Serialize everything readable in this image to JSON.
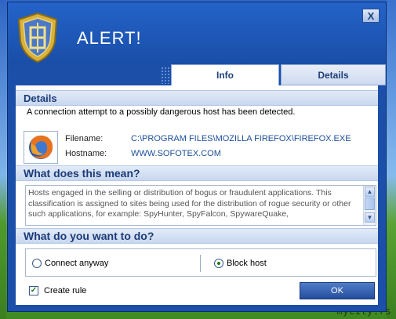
{
  "window": {
    "title": "ALERT!",
    "close_label": "X"
  },
  "tabs": [
    {
      "label": "Info",
      "active": true
    },
    {
      "label": "Details",
      "active": false
    }
  ],
  "details": {
    "heading": "Details",
    "message": "A connection attempt to a possibly dangerous host has been detected.",
    "filename_label": "Filename:",
    "filename_value": "C:\\PROGRAM FILES\\MOZILLA FIREFOX\\FIREFOX.EXE",
    "hostname_label": "Hostname:",
    "hostname_value": "WWW.SOFOTEX.COM",
    "app_icon": "firefox-icon"
  },
  "meaning": {
    "heading": "What does this mean?",
    "description": "Hosts engaged in the selling or distribution of bogus or fraudulent applications. This classification is assigned to sites being used for the distribution of rogue security or other such applications, for example: SpyHunter, SpyFalcon, SpywareQuake,"
  },
  "action": {
    "heading": "What do you want to do?",
    "options": [
      {
        "label": "Connect anyway",
        "selected": false
      },
      {
        "label": "Block host",
        "selected": true
      }
    ],
    "create_rule_label": "Create rule",
    "create_rule_checked": true,
    "ok_label": "OK"
  },
  "watermark": "mycity.rs",
  "colors": {
    "header_blue": "#1d56b5",
    "section_text": "#1d3b78",
    "link_blue": "#1c4f9a",
    "shield_gold": "#d8b23a"
  }
}
